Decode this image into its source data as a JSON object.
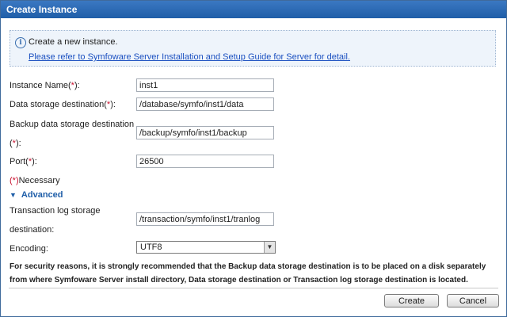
{
  "dialog": {
    "title": "Create Instance"
  },
  "info": {
    "icon": "info-icon",
    "message": "Create a new instance.",
    "link": "Please refer to Symfoware Server Installation and Setup Guide for Server for detail."
  },
  "form": {
    "instance_name": {
      "label": "Instance Name(",
      "req": "*",
      "tail": "):",
      "value": "inst1"
    },
    "data_storage": {
      "label": "Data storage destination(",
      "req": "*",
      "tail": "):",
      "value": "/database/symfo/inst1/data"
    },
    "backup_storage": {
      "label_line1": "Backup data storage destination",
      "label_line2_pre": "(",
      "req": "*",
      "label_line2_post": "):",
      "value": "/backup/symfo/inst1/backup"
    },
    "port": {
      "label": "Port(",
      "req": "*",
      "tail": "):",
      "value": "26500"
    },
    "necessary": {
      "req": "(*)",
      "text": "Necessary"
    }
  },
  "advanced": {
    "label": "Advanced",
    "toggle_icon": "triangle-down-icon",
    "transaction_log": {
      "label_line1": "Transaction log storage",
      "label_line2": "destination:",
      "value": "/transaction/symfo/inst1/tranlog"
    },
    "encoding": {
      "label": "Encoding:",
      "value": "UTF8"
    }
  },
  "warning": "For security reasons, it is strongly recommended that the Backup data storage destination is to be placed on a disk separately from where Symfoware Server install directory, Data storage destination or Transaction log storage destination is located.",
  "buttons": {
    "create": "Create",
    "cancel": "Cancel"
  },
  "colors": {
    "titlebar": "#2a6bb7",
    "required": "#c8102e",
    "link": "#1a4fc0",
    "accent": "#1f5ea8"
  }
}
